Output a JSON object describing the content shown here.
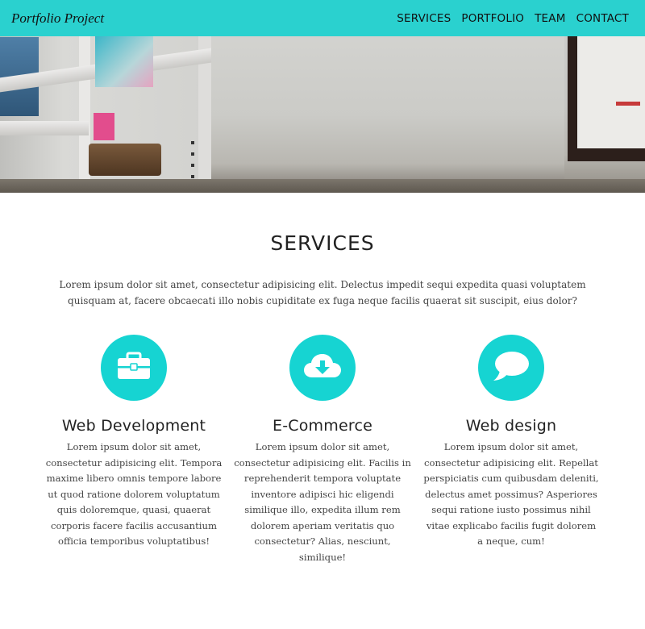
{
  "navbar": {
    "brand": "Portfolio Project",
    "links": [
      "SERVICES",
      "PORTFOLIO",
      "TEAM",
      "CONTACT"
    ],
    "background": "#2ad1cf"
  },
  "services": {
    "title": "SERVICES",
    "intro": "Lorem ipsum dolor sit amet, consectetur adipisicing elit. Delectus impedit sequi expedita quasi voluptatem quisquam at, facere obcaecati illo nobis cupiditate ex fuga neque facilis quaerat sit suscipit, eius dolor?",
    "accent": "#16d4d2",
    "items": [
      {
        "icon": "briefcase-icon",
        "title": "Web Development",
        "text": "Lorem ipsum dolor sit amet, consectetur adipisicing elit. Tempora maxime libero omnis tempore labore ut quod ratione dolorem voluptatum quis doloremque, quasi, quaerat corporis facere facilis accusantium officia temporibus voluptatibus!"
      },
      {
        "icon": "cloud-download-icon",
        "title": "E-Commerce",
        "text": "Lorem ipsum dolor sit amet, consectetur adipisicing elit. Facilis in reprehenderit tempora voluptate inventore adipisci hic eligendi similique illo, expedita illum rem dolorem aperiam veritatis quo consectetur? Alias, nesciunt, similique!"
      },
      {
        "icon": "speech-bubble-icon",
        "title": "Web design",
        "text": "Lorem ipsum dolor sit amet, consectetur adipisicing elit. Repellat perspiciatis cum quibusdam deleniti, delectus amet possimus? Asperiores sequi ratione iusto possimus nihil vitae explicabo facilis fugit dolorem a neque, cum!"
      }
    ]
  }
}
